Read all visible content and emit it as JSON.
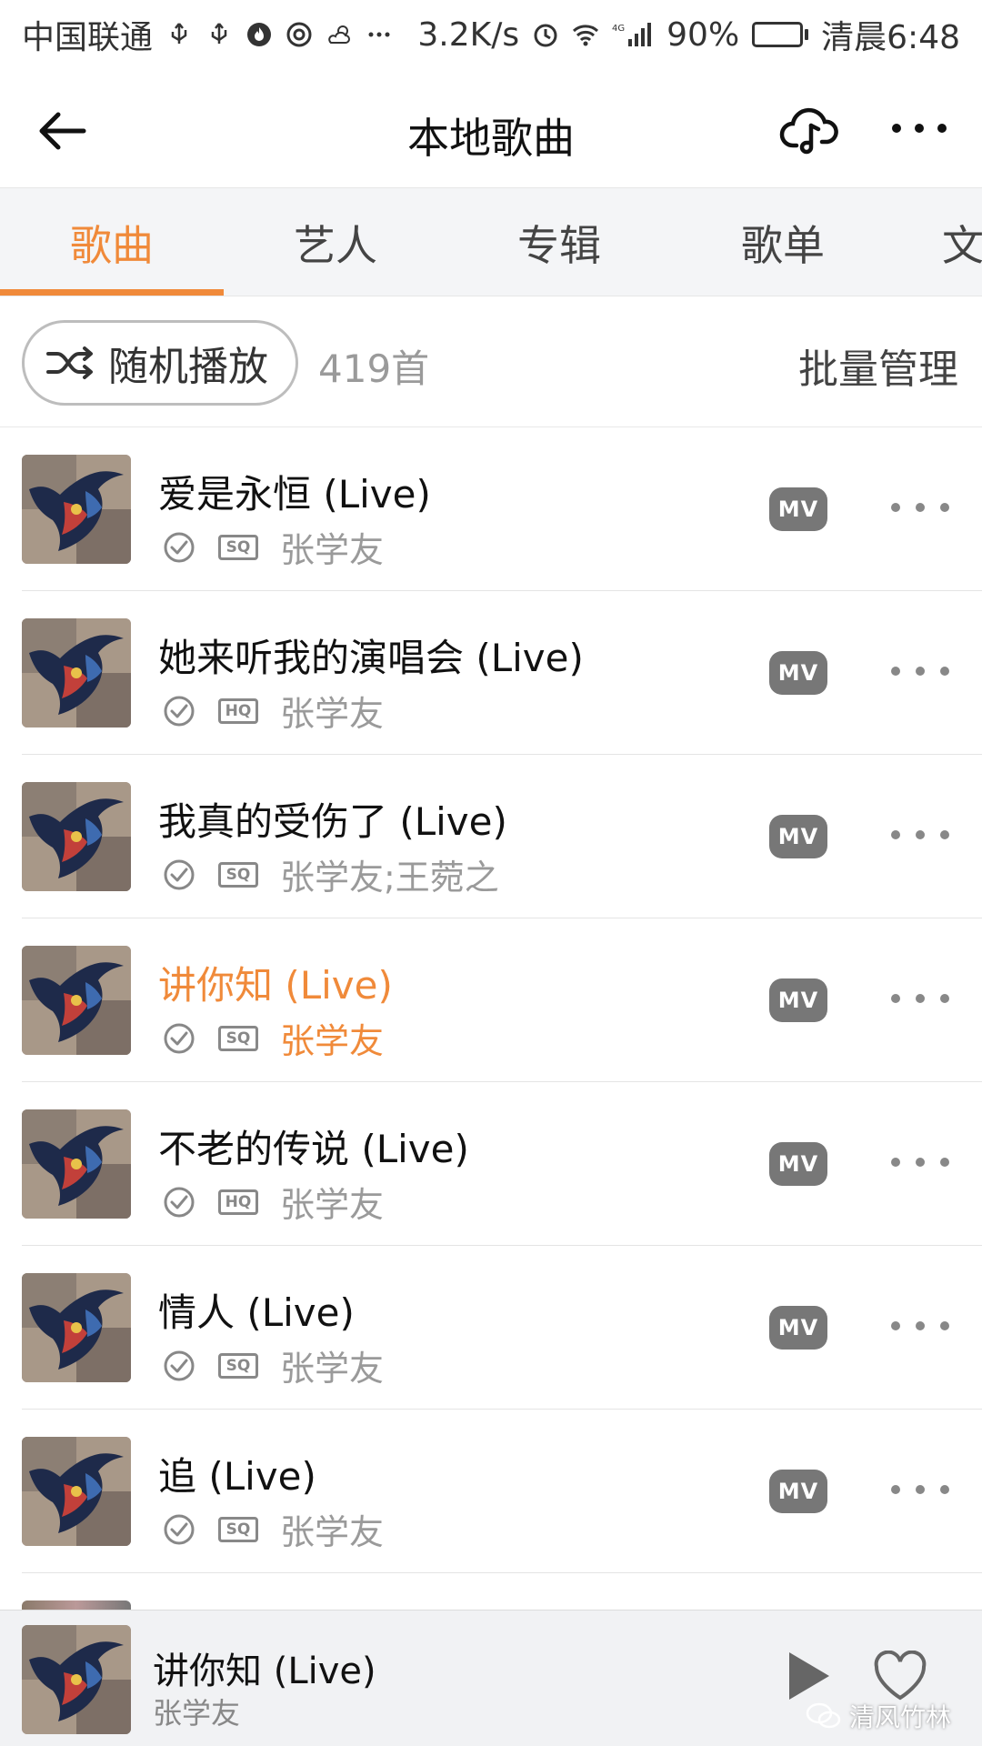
{
  "status_bar": {
    "carrier": "中国联通",
    "net_speed": "3.2K/s",
    "network_type": "4G",
    "battery_percent": "90%",
    "battery_level": 0.9,
    "time": "清晨6:48",
    "icons": [
      "usb-icon",
      "usb-icon",
      "flame-app-icon",
      "swirl-app-icon",
      "weather-icon",
      "more-dots-icon",
      "alarm-icon",
      "wifi-icon",
      "signal-icon",
      "battery-icon"
    ]
  },
  "header": {
    "title": "本地歌曲"
  },
  "tabs": [
    {
      "label": "歌曲",
      "active": true
    },
    {
      "label": "艺人",
      "active": false
    },
    {
      "label": "专辑",
      "active": false
    },
    {
      "label": "歌单",
      "active": false
    },
    {
      "label": "文",
      "active": false
    }
  ],
  "actions": {
    "shuffle_label": "随机播放",
    "song_count": "419首",
    "batch_label": "批量管理"
  },
  "songs": [
    {
      "title": "爱是永恒 (Live)",
      "quality": "SQ",
      "artist": "张学友",
      "mv": "MV",
      "playing": false
    },
    {
      "title": "她来听我的演唱会 (Live)",
      "quality": "HQ",
      "artist": "张学友",
      "mv": "MV",
      "playing": false
    },
    {
      "title": "我真的受伤了 (Live)",
      "quality": "SQ",
      "artist": "张学友;王菀之",
      "mv": "MV",
      "playing": false
    },
    {
      "title": "讲你知 (Live)",
      "quality": "SQ",
      "artist": "张学友",
      "mv": "MV",
      "playing": true
    },
    {
      "title": "不老的传说 (Live)",
      "quality": "HQ",
      "artist": "张学友",
      "mv": "MV",
      "playing": false
    },
    {
      "title": "情人 (Live)",
      "quality": "SQ",
      "artist": "张学友",
      "mv": "MV",
      "playing": false
    },
    {
      "title": "追 (Live)",
      "quality": "SQ",
      "artist": "张学友",
      "mv": "MV",
      "playing": false
    }
  ],
  "player": {
    "title": "讲你知 (Live)",
    "artist": "张学友"
  },
  "watermark": "清风竹林",
  "colors": {
    "accent": "#f08a3a",
    "tab_bg": "#f4f5f7",
    "secondary_text": "#9a9a9a",
    "mv_badge": "#777777"
  }
}
